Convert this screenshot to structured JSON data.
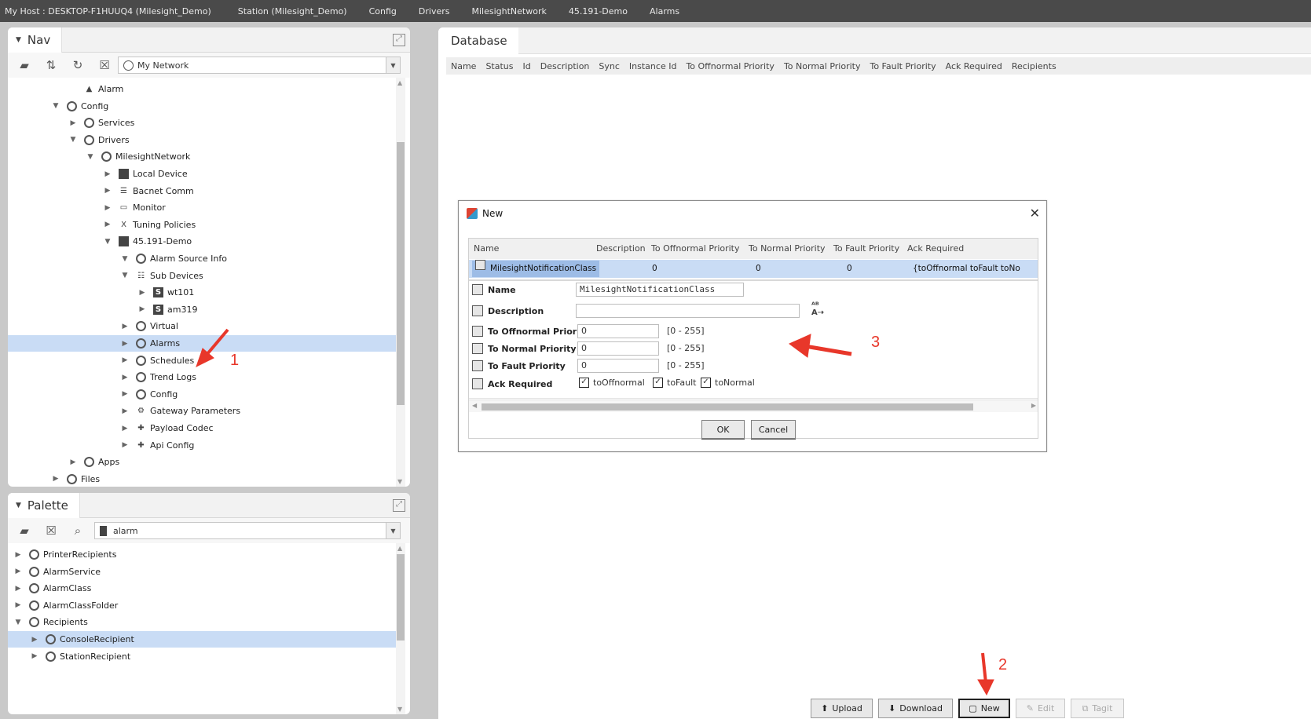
{
  "breadcrumb": [
    "My Host : DESKTOP-F1HUUQ4 (Milesight_Demo)",
    "Station (Milesight_Demo)",
    "Config",
    "Drivers",
    "MilesightNetwork",
    "45.191-Demo",
    "Alarms"
  ],
  "nav": {
    "title": "Nav",
    "network_select": "My Network",
    "tree": [
      {
        "label": "Alarm",
        "depth": 3,
        "toggle": "",
        "icon": "bell-icon",
        "selected": false
      },
      {
        "label": "Config",
        "depth": 2,
        "toggle": "open",
        "icon": "config-icon",
        "selected": false
      },
      {
        "label": "Services",
        "depth": 3,
        "toggle": "closed",
        "icon": "services-icon",
        "selected": false
      },
      {
        "label": "Drivers",
        "depth": 3,
        "toggle": "open",
        "icon": "drivers-icon",
        "selected": false
      },
      {
        "label": "MilesightNetwork",
        "depth": 4,
        "toggle": "open",
        "icon": "network-icon",
        "selected": false
      },
      {
        "label": "Local Device",
        "depth": 5,
        "toggle": "closed",
        "icon": "device-icon",
        "selected": false
      },
      {
        "label": "Bacnet Comm",
        "depth": 5,
        "toggle": "closed",
        "icon": "comm-icon",
        "selected": false
      },
      {
        "label": "Monitor",
        "depth": 5,
        "toggle": "closed",
        "icon": "monitor-icon",
        "selected": false
      },
      {
        "label": "Tuning Policies",
        "depth": 5,
        "toggle": "closed",
        "icon": "tuning-icon",
        "selected": false
      },
      {
        "label": "45.191-Demo",
        "depth": 5,
        "toggle": "open",
        "icon": "station-icon",
        "selected": false
      },
      {
        "label": "Alarm Source Info",
        "depth": 6,
        "toggle": "open",
        "icon": "alarm-source-icon",
        "selected": false
      },
      {
        "label": "Sub Devices",
        "depth": 6,
        "toggle": "open",
        "icon": "subdevices-icon",
        "selected": false
      },
      {
        "label": "wt101",
        "depth": 7,
        "toggle": "closed",
        "icon": "s-device-icon",
        "selected": false
      },
      {
        "label": "am319",
        "depth": 7,
        "toggle": "closed",
        "icon": "s-device-icon",
        "selected": false
      },
      {
        "label": "Virtual",
        "depth": 6,
        "toggle": "closed",
        "icon": "virtual-icon",
        "selected": false
      },
      {
        "label": "Alarms",
        "depth": 6,
        "toggle": "closed",
        "icon": "alarms-icon",
        "selected": true
      },
      {
        "label": "Schedules",
        "depth": 6,
        "toggle": "closed",
        "icon": "schedules-icon",
        "selected": false
      },
      {
        "label": "Trend Logs",
        "depth": 6,
        "toggle": "closed",
        "icon": "trendlogs-icon",
        "selected": false
      },
      {
        "label": "Config",
        "depth": 6,
        "toggle": "closed",
        "icon": "globe-icon",
        "selected": false
      },
      {
        "label": "Gateway Parameters",
        "depth": 6,
        "toggle": "closed",
        "icon": "gear-icon",
        "selected": false
      },
      {
        "label": "Payload Codec",
        "depth": 6,
        "toggle": "closed",
        "icon": "puzzle-icon",
        "selected": false
      },
      {
        "label": "Api Config",
        "depth": 6,
        "toggle": "closed",
        "icon": "puzzle-icon",
        "selected": false
      },
      {
        "label": "Apps",
        "depth": 3,
        "toggle": "closed",
        "icon": "apps-icon",
        "selected": false
      },
      {
        "label": "Files",
        "depth": 2,
        "toggle": "closed",
        "icon": "files-icon",
        "selected": false
      }
    ]
  },
  "palette": {
    "title": "Palette",
    "module_select": "alarm",
    "tree": [
      {
        "label": "PrinterRecipients",
        "depth": 0,
        "toggle": "closed",
        "icon": "printer-recipients-icon",
        "selected": false
      },
      {
        "label": "AlarmService",
        "depth": 0,
        "toggle": "closed",
        "icon": "alarm-service-icon",
        "selected": false
      },
      {
        "label": "AlarmClass",
        "depth": 0,
        "toggle": "closed",
        "icon": "alarm-class-icon",
        "selected": false
      },
      {
        "label": "AlarmClassFolder",
        "depth": 0,
        "toggle": "closed",
        "icon": "alarm-class-folder-icon",
        "selected": false
      },
      {
        "label": "Recipients",
        "depth": 0,
        "toggle": "open",
        "icon": "recipients-icon",
        "selected": false
      },
      {
        "label": "ConsoleRecipient",
        "depth": 1,
        "toggle": "closed",
        "icon": "console-recipient-icon",
        "selected": true
      },
      {
        "label": "StationRecipient",
        "depth": 1,
        "toggle": "closed",
        "icon": "station-recipient-icon",
        "selected": false
      }
    ]
  },
  "database": {
    "title": "Database",
    "columns": [
      "Name",
      "Status",
      "Id",
      "Description",
      "Sync",
      "Instance Id",
      "To Offnormal Priority",
      "To Normal Priority",
      "To Fault Priority",
      "Ack Required",
      "Recipients"
    ],
    "buttons": {
      "upload": "Upload",
      "download": "Download",
      "new": "New",
      "edit": "Edit",
      "tagit": "Tagit"
    }
  },
  "dialog": {
    "title": "New",
    "columns": [
      "Name",
      "Description",
      "To Offnormal Priority",
      "To Normal Priority",
      "To Fault Priority",
      "Ack Required"
    ],
    "row": {
      "name": "MilesightNotificationClass",
      "description": "",
      "to_offnormal": "0",
      "to_normal": "0",
      "to_fault": "0",
      "ack_required": "{toOffnormal toFault toNo"
    },
    "labels": {
      "name": "Name",
      "description": "Description",
      "to_offnormal": "To Offnormal Priority",
      "to_normal": "To Normal Priority",
      "to_fault": "To Fault Priority",
      "ack_required": "Ack Required"
    },
    "values": {
      "name": "MilesightNotificationClass",
      "description": "",
      "to_offnormal": "0",
      "to_normal": "0",
      "to_fault": "0"
    },
    "range": "[0 - 255]",
    "ack": [
      {
        "label": "toOffnormal",
        "checked": true
      },
      {
        "label": "toFault",
        "checked": true
      },
      {
        "label": "toNormal",
        "checked": true
      }
    ],
    "ok": "OK",
    "cancel": "Cancel"
  },
  "annotations": [
    "1",
    "2",
    "3"
  ]
}
